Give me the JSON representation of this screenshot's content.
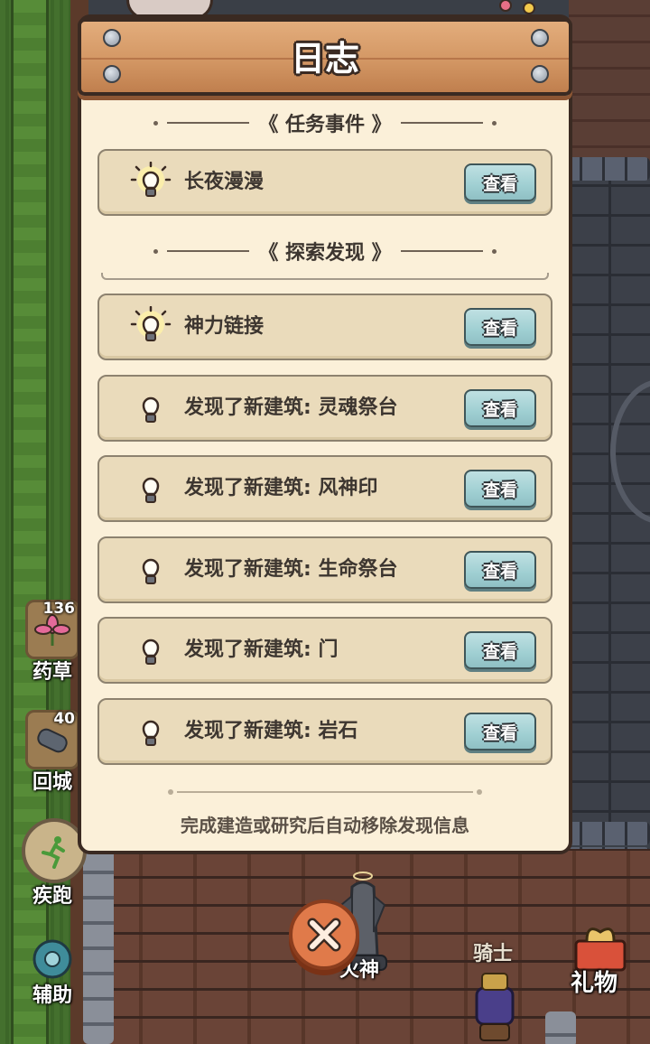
{
  "dialog": {
    "title": "日志",
    "sections": {
      "tasks": {
        "label": "任务事件"
      },
      "explore": {
        "label": "探索发现"
      }
    },
    "entries": [
      {
        "text": "长夜漫漫",
        "lit": true,
        "button": "查看"
      },
      {
        "text": "神力链接",
        "lit": true,
        "button": "查看"
      },
      {
        "text": "发现了新建筑: 灵魂祭台",
        "lit": false,
        "button": "查看"
      },
      {
        "text": "发现了新建筑: 风神印",
        "lit": false,
        "button": "查看"
      },
      {
        "text": "发现了新建筑: 生命祭台",
        "lit": false,
        "button": "查看"
      },
      {
        "text": "发现了新建筑: 门",
        "lit": false,
        "button": "查看"
      },
      {
        "text": "发现了新建筑: 岩石",
        "lit": false,
        "button": "查看"
      }
    ],
    "footer_note": "完成建造或研究后自动移除发现信息"
  },
  "hud": {
    "herb": {
      "count": "136",
      "label": "药草"
    },
    "return_city": {
      "count": "40",
      "label": "回城"
    },
    "sprint": {
      "label": "疾跑"
    },
    "assist": {
      "label": "辅助"
    }
  },
  "world": {
    "statue_label": "火神",
    "knight_label": "骑士",
    "gift_label": "礼物"
  },
  "colors": {
    "panel_bg": "#fbf0d9",
    "row_bg": "#eadbbb",
    "plank": "#d39764",
    "view_button": "#9fcfd2",
    "close_button": "#e07a4a"
  }
}
